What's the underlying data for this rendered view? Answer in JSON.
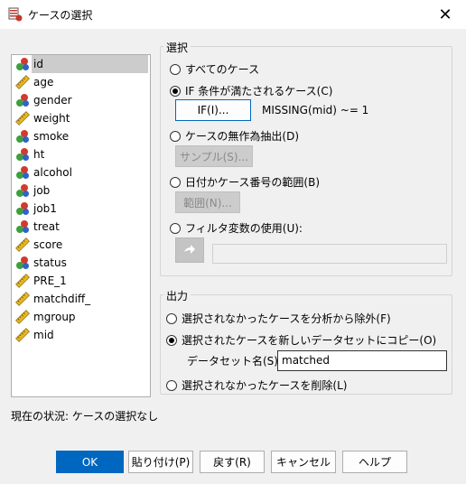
{
  "window": {
    "title": "ケースの選択",
    "close_glyph": "✕"
  },
  "variables": [
    {
      "name": "id",
      "icon": "nominal-icon",
      "selected": true
    },
    {
      "name": "age",
      "icon": "scale-icon"
    },
    {
      "name": "gender",
      "icon": "nominal-icon"
    },
    {
      "name": "weight",
      "icon": "scale-icon"
    },
    {
      "name": "smoke",
      "icon": "nominal-icon"
    },
    {
      "name": "ht",
      "icon": "nominal-icon"
    },
    {
      "name": "alcohol",
      "icon": "nominal-icon"
    },
    {
      "name": "job",
      "icon": "nominal-icon"
    },
    {
      "name": "job1",
      "icon": "nominal-icon"
    },
    {
      "name": "treat",
      "icon": "nominal-icon"
    },
    {
      "name": "score",
      "icon": "scale-icon"
    },
    {
      "name": "status",
      "icon": "nominal-icon"
    },
    {
      "name": "PRE_1",
      "icon": "scale-icon"
    },
    {
      "name": "matchdiff_",
      "icon": "scale-icon"
    },
    {
      "name": "mgroup",
      "icon": "scale-icon"
    },
    {
      "name": "mid",
      "icon": "scale-icon"
    }
  ],
  "selection": {
    "title": "選択",
    "all_cases": "すべてのケース",
    "if_condition": "IF 条件が満たされるケース(C)",
    "if_button": "IF(I)...",
    "condition_text": "MISSING(mid) ~= 1",
    "random_sample": "ケースの無作為抽出(D)",
    "sample_button": "サンプル(S)...",
    "date_range": "日付かケース番号の範囲(B)",
    "range_button": "範囲(N)...",
    "filter_variable": "フィルタ変数の使用(U):",
    "selected_option": "if_condition"
  },
  "output": {
    "title": "出力",
    "filter_out": "選択されなかったケースを分析から除外(F)",
    "copy_to_dataset": "選択されたケースを新しいデータセットにコピー(O)",
    "dataset_label": "データセット名(S):",
    "dataset_value": "matched",
    "delete_unselected": "選択されなかったケースを削除(L)",
    "selected_option": "copy_to_dataset"
  },
  "status": "現在の状況: ケースの選択なし",
  "buttons": {
    "ok": "OK",
    "paste": "貼り付け(P)",
    "reset": "戻す(R)",
    "cancel": "キャンセル",
    "help": "ヘルプ"
  },
  "colors": {
    "accent": "#0067c0",
    "selected_row": "#cccccc",
    "nominal_red": "#d33a2c",
    "nominal_green": "#3ca03c",
    "nominal_blue": "#2f63c8",
    "scale_yellow": "#e8b820"
  }
}
